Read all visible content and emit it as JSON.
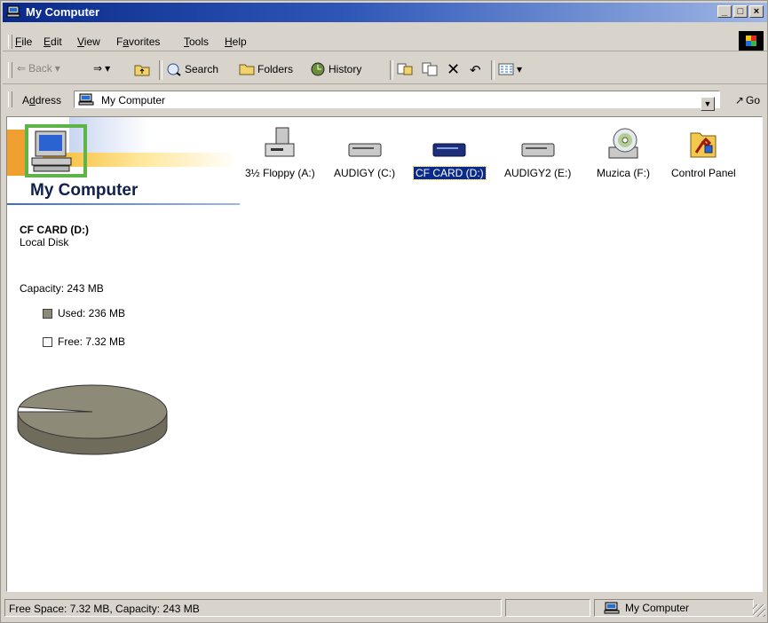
{
  "window": {
    "title": "My Computer"
  },
  "menu": [
    {
      "pre": "",
      "u": "F",
      "post": "ile"
    },
    {
      "pre": "",
      "u": "E",
      "post": "dit"
    },
    {
      "pre": "",
      "u": "V",
      "post": "iew"
    },
    {
      "pre": "F",
      "u": "a",
      "post": "vorites"
    },
    {
      "pre": "",
      "u": "T",
      "post": "ools"
    },
    {
      "pre": "",
      "u": "H",
      "post": "elp"
    }
  ],
  "toolbar": {
    "back": "Back",
    "search": "Search",
    "folders": "Folders",
    "history": "History"
  },
  "address": {
    "label_pre": "A",
    "label_u": "d",
    "label_post": "dress",
    "value": "My Computer",
    "go": "Go"
  },
  "left_pane": {
    "title": "My Computer",
    "drive_name": "CF CARD (D:)",
    "drive_type": "Local Disk",
    "capacity": "Capacity: 243 MB",
    "used": "Used: 236 MB",
    "free": "Free: 7.32 MB",
    "used_fraction": 0.971
  },
  "drives": [
    {
      "label": "3½ Floppy (A:)",
      "icon": "floppy-drive-icon",
      "selected": false
    },
    {
      "label": "AUDIGY (C:)",
      "icon": "hard-disk-icon",
      "selected": false
    },
    {
      "label": "CF CARD (D:)",
      "icon": "hard-disk-icon",
      "selected": true
    },
    {
      "label": "AUDIGY2 (E:)",
      "icon": "hard-disk-icon",
      "selected": false
    },
    {
      "label": "Muzica (F:)",
      "icon": "cd-drive-icon",
      "selected": false
    },
    {
      "label": "Control Panel",
      "icon": "control-panel-icon",
      "selected": false
    }
  ],
  "status": {
    "left": "Free Space: 7.32 MB, Capacity: 243 MB",
    "right": "My Computer"
  },
  "colors": {
    "selection": "#0a2a8a",
    "used": "#8d8a78",
    "free": "#ffffff",
    "chrome": "#d8d4cc"
  }
}
